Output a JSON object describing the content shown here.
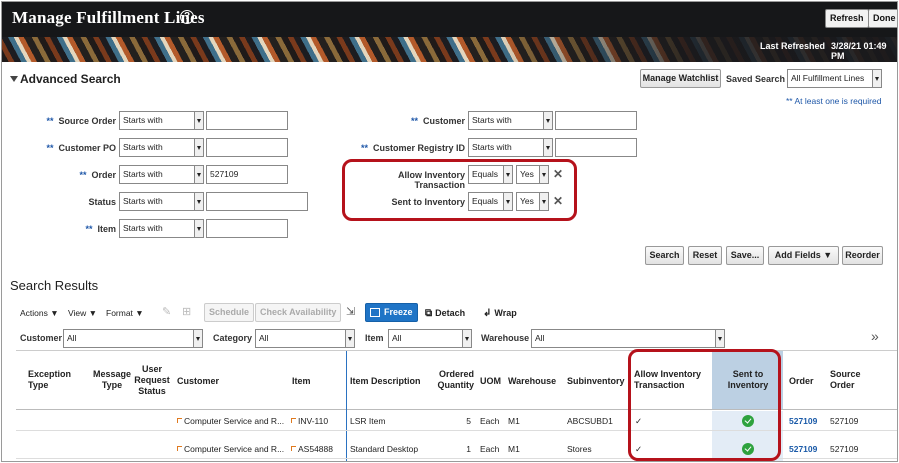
{
  "header": {
    "title": "Manage Fulfillment Lines",
    "help_glyph": "?",
    "refresh": "Refresh",
    "done": "Done",
    "last_refreshed_label": "Last Refreshed",
    "last_refreshed_value": "3/28/21 01:49 PM"
  },
  "search": {
    "title": "Advanced Search",
    "manage_watchlist": "Manage Watchlist",
    "saved_search_label": "Saved Search",
    "saved_search_value": "All Fulfillment Lines",
    "required_note": "** At least one is required",
    "fields": {
      "source_order": {
        "label": "Source Order",
        "op": "Starts with",
        "value": ""
      },
      "customer_po": {
        "label": "Customer PO",
        "op": "Starts with",
        "value": ""
      },
      "order": {
        "label": "Order",
        "op": "Starts with",
        "value": "527109"
      },
      "status": {
        "label": "Status",
        "op": "Starts with",
        "value": ""
      },
      "item": {
        "label": "Item",
        "op": "Starts with",
        "value": ""
      },
      "customer": {
        "label": "Customer",
        "op": "Starts with",
        "value": ""
      },
      "customer_registry_id": {
        "label": "Customer Registry ID",
        "op": "Starts with",
        "value": ""
      },
      "allow_inventory_transaction": {
        "label": "Allow Inventory Transaction",
        "op": "Equals",
        "value": "Yes"
      },
      "sent_to_inventory": {
        "label": "Sent to Inventory",
        "op": "Equals",
        "value": "Yes"
      }
    },
    "req_marker": "**",
    "remove_glyph": "✕",
    "buttons": {
      "search": "Search",
      "reset": "Reset",
      "save": "Save...",
      "add_fields": "Add Fields ▼",
      "reorder": "Reorder"
    }
  },
  "results": {
    "title": "Search Results",
    "toolbar": {
      "actions": "Actions ▼",
      "view": "View ▼",
      "format": "Format ▼",
      "schedule": "Schedule",
      "check_availability": "Check Availability",
      "freeze": "Freeze",
      "detach": "Detach",
      "wrap": "Wrap"
    },
    "filters": {
      "customer_label": "Customer",
      "customer_value": "All",
      "category_label": "Category",
      "category_value": "All",
      "item_label": "Item",
      "item_value": "All",
      "warehouse_label": "Warehouse",
      "warehouse_value": "All",
      "more": "»"
    },
    "columns": {
      "exception_type": "Exception Type",
      "message_type": "Message Type",
      "user_request_status": "User Request Status",
      "customer": "Customer",
      "item": "Item",
      "item_description": "Item Description",
      "ordered_quantity": "Ordered Quantity",
      "uom": "UOM",
      "warehouse": "Warehouse",
      "subinventory": "Subinventory",
      "allow_inventory_transaction": "Allow Inventory Transaction",
      "sent_to_inventory": "Sent to Inventory",
      "order": "Order",
      "source_order": "Source Order"
    },
    "rows": [
      {
        "customer": "Computer Service and R...",
        "item": "INV-110",
        "item_description": "LSR Item",
        "ordered_quantity": "5",
        "uom": "Each",
        "warehouse": "M1",
        "subinventory": "ABCSUBD1",
        "allow_inventory_transaction": "✓",
        "sent_to_inventory": true,
        "order": "527109",
        "source_order": "527109"
      },
      {
        "customer": "Computer Service and R...",
        "item": "AS54888",
        "item_description": "Standard Desktop",
        "ordered_quantity": "1",
        "uom": "Each",
        "warehouse": "M1",
        "subinventory": "Stores",
        "allow_inventory_transaction": "✓",
        "sent_to_inventory": true,
        "order": "527109",
        "source_order": "527109"
      }
    ]
  },
  "colors": {
    "highlight_box": "#b5121b",
    "accent_blue": "#1f74c6",
    "success_green": "#2ea23e",
    "selected_column": "#bcd0e3"
  }
}
